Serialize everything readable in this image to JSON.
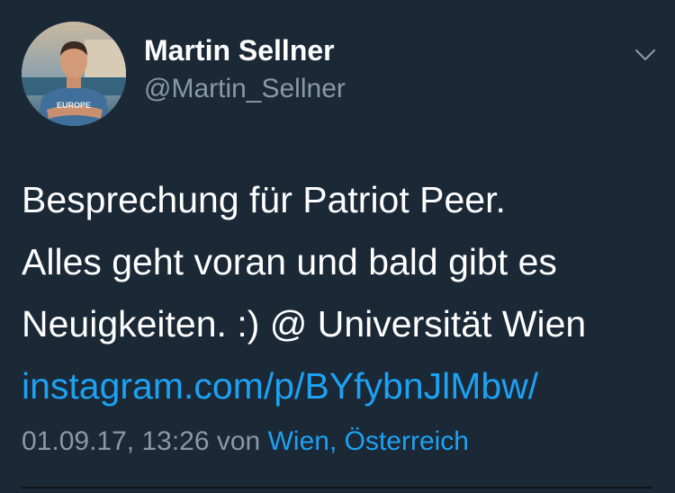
{
  "tweet": {
    "author_name": "Martin Sellner",
    "author_handle": "@Martin_Sellner",
    "menu_icon": "chevron-down-icon",
    "avatar_shirt_text": "EUROPE",
    "text_lines": [
      "Besprechung für Patriot Peer.",
      "Alles geht voran und bald gibt es",
      "Neuigkeiten. :) @ Universität Wien"
    ],
    "link": "instagram.com/p/BYfybnJlMbw/",
    "date": "01.09.17, 13:26",
    "via": "von",
    "location": "Wien, Österreich"
  },
  "colors": {
    "background": "#1b2836",
    "text": "#ffffff",
    "muted": "#8899a6",
    "link": "#1da1f2"
  }
}
